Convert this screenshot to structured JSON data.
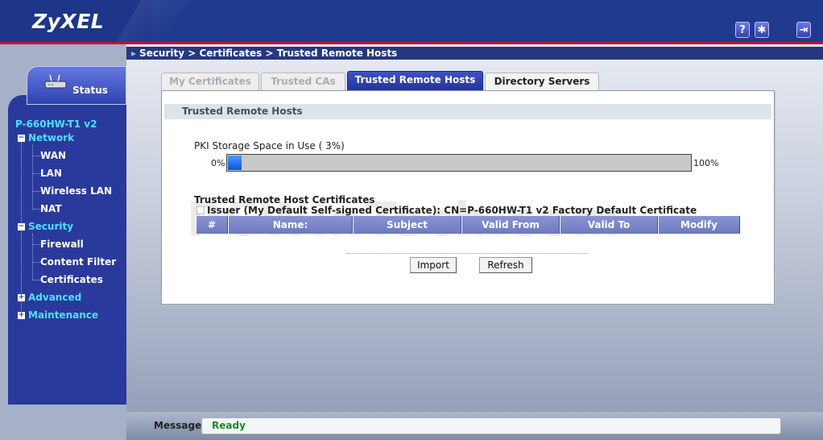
{
  "header": {
    "logo": "ZyXEL",
    "icons": [
      {
        "name": "help-icon",
        "glyph": "?"
      },
      {
        "name": "wizard-icon",
        "glyph": "✱"
      },
      {
        "name": "logout-icon",
        "glyph": "⇥"
      }
    ]
  },
  "breadcrumb": "Security > Certificates > Trusted Remote Hosts",
  "sidebar": {
    "status_label": "Status",
    "device": "P-660HW-T1 v2",
    "groups": [
      {
        "label": "Network",
        "expander": "−",
        "items": [
          "WAN",
          "LAN",
          "Wireless LAN",
          "NAT"
        ]
      },
      {
        "label": "Security",
        "expander": "−",
        "items": [
          "Firewall",
          "Content Filter",
          "Certificates"
        ]
      },
      {
        "label": "Advanced",
        "expander": "+",
        "items": []
      },
      {
        "label": "Maintenance",
        "expander": "+",
        "items": []
      }
    ]
  },
  "tabs": [
    {
      "label": "My Certificates",
      "state": "inactive"
    },
    {
      "label": "Trusted CAs",
      "state": "inactive"
    },
    {
      "label": "Trusted Remote Hosts",
      "state": "active"
    },
    {
      "label": "Directory Servers",
      "state": "normal"
    }
  ],
  "panel": {
    "section_title": "Trusted Remote Hosts",
    "pki_label": "PKI Storage Space in Use ( 3%)",
    "pki_usage_percent": 3,
    "bar_min_label": "0%",
    "bar_max_label": "100%",
    "certs_title": "Trusted Remote Host Certificates",
    "issuer_text": "Issuer (My Default Self-signed Certificate): CN=P-660HW-T1 v2 Factory Default Certificate",
    "table_headers": [
      "#",
      "Name:",
      "Subject",
      "Valid From",
      "Valid To",
      "Modify"
    ],
    "watermark": "PCWinTech.com",
    "buttons": {
      "import": "Import",
      "refresh": "Refresh"
    }
  },
  "message": {
    "label": "Message",
    "value": "Ready",
    "value_color": "#1a8a26"
  },
  "colors": {
    "header_bg": "#1f3a8f",
    "accent_red": "#c8102e",
    "nav_cyan": "#4ee0ff",
    "tab_active": "#23339a"
  }
}
